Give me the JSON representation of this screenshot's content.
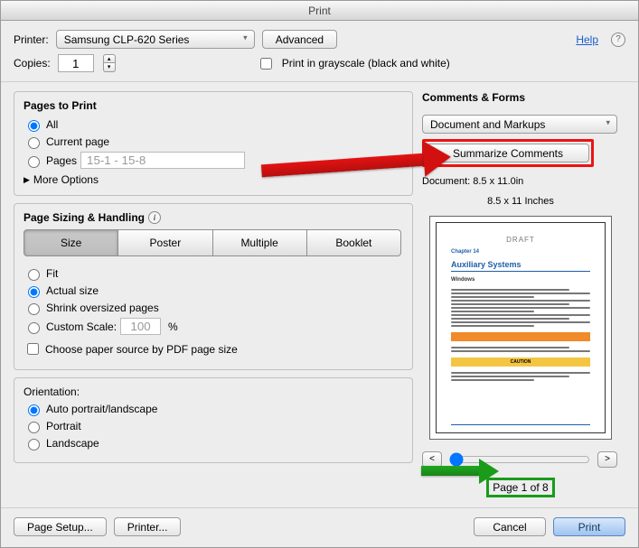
{
  "window": {
    "title": "Print"
  },
  "header": {
    "printer_label": "Printer:",
    "printer_value": "Samsung CLP-620 Series",
    "advanced": "Advanced",
    "help": "Help",
    "copies_label": "Copies:",
    "copies_value": "1",
    "grayscale_label": "Print in grayscale (black and white)"
  },
  "pages": {
    "title": "Pages to Print",
    "all": "All",
    "current": "Current page",
    "pages": "Pages",
    "range_value": "15-1 - 15-8",
    "more_options": "More Options"
  },
  "sizing": {
    "title": "Page Sizing & Handling",
    "segments": {
      "size": "Size",
      "poster": "Poster",
      "multiple": "Multiple",
      "booklet": "Booklet"
    },
    "fit": "Fit",
    "actual": "Actual size",
    "shrink": "Shrink oversized pages",
    "custom_scale": "Custom Scale:",
    "custom_value": "100",
    "percent": "%",
    "choose_source": "Choose paper source by PDF page size"
  },
  "orientation": {
    "title": "Orientation:",
    "auto": "Auto portrait/landscape",
    "portrait": "Portrait",
    "landscape": "Landscape"
  },
  "comments": {
    "title": "Comments & Forms",
    "select_value": "Document and Markups",
    "summarize": "Summarize Comments"
  },
  "preview": {
    "doc_size": "Document: 8.5 x 11.0in",
    "caption": "8.5 x 11 Inches",
    "thumb": {
      "draft": "DRAFT",
      "chapter": "Chapter 14",
      "heading": "Auxiliary Systems",
      "sub": "Windows",
      "caution": "CAUTION"
    },
    "prev": "<",
    "next": ">",
    "page_of": "Page 1 of 8"
  },
  "footer": {
    "page_setup": "Page Setup...",
    "printer": "Printer...",
    "cancel": "Cancel",
    "print": "Print"
  }
}
